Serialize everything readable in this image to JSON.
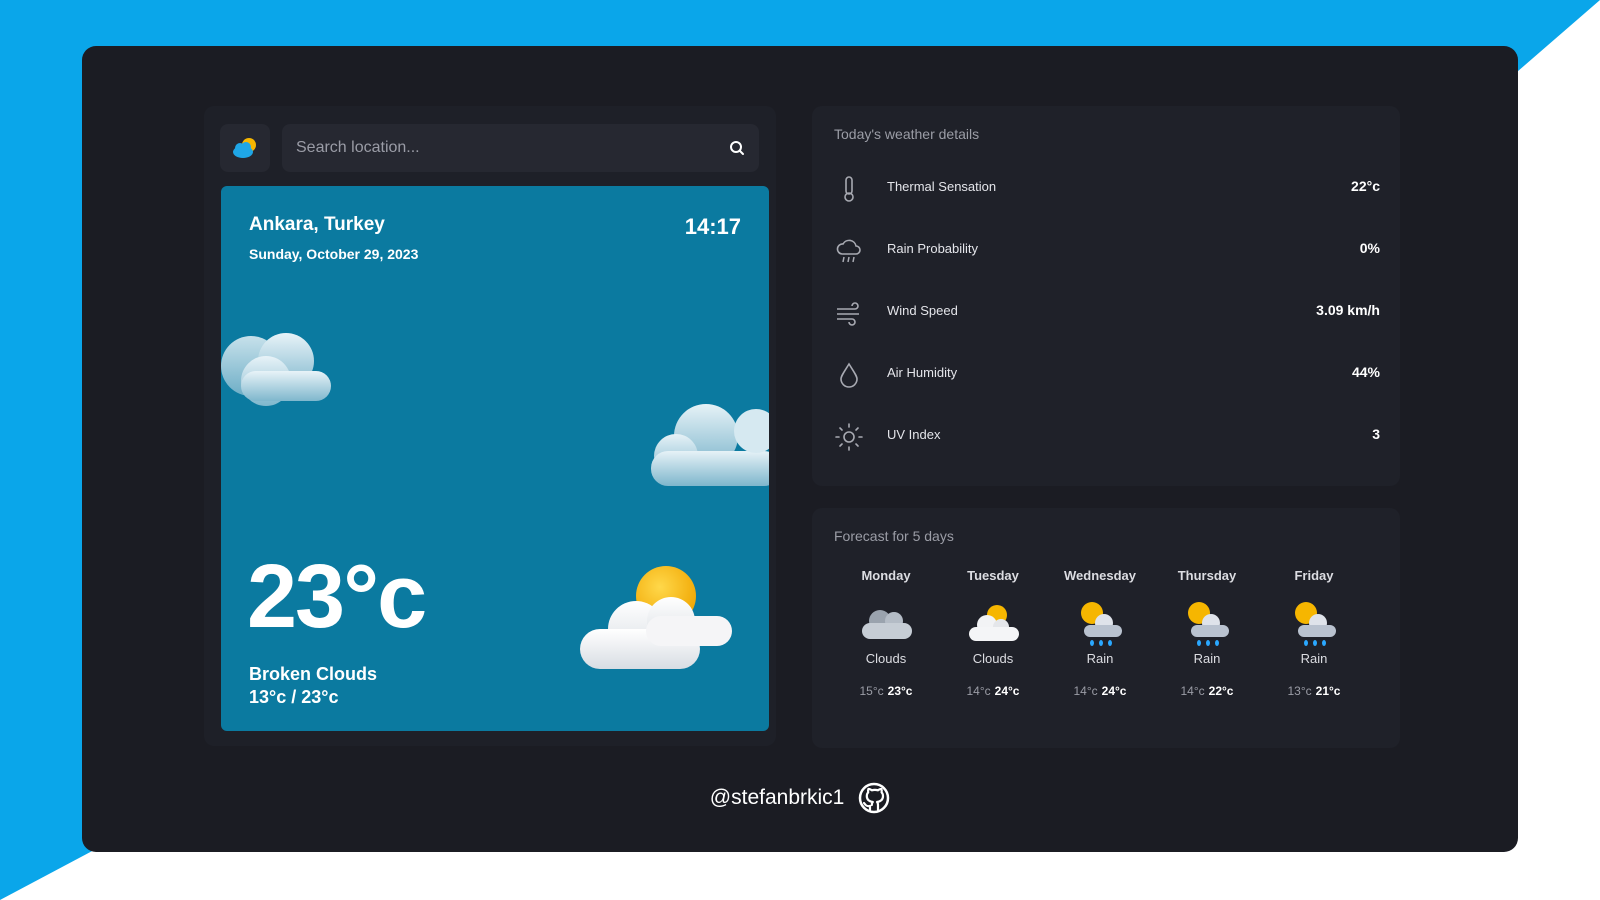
{
  "colors": {
    "background_blue": "#0aa6ea",
    "frame": "#1b1c23",
    "panel": "#1f2129",
    "card": "#0b7aa0",
    "sun": "#f6b600"
  },
  "app": {
    "logo_icon": "sun-cloud-logo-icon"
  },
  "search": {
    "placeholder": "Search location...",
    "icon": "search-icon"
  },
  "current": {
    "location": "Ankara, Turkey",
    "date": "Sunday, October 29, 2023",
    "time": "14:17",
    "temperature": "23°c",
    "condition": "Broken Clouds",
    "range": "13°c / 23°c"
  },
  "details": {
    "title": "Today's weather details",
    "items": [
      {
        "icon": "thermometer-icon",
        "label": "Thermal Sensation",
        "value": "22°c"
      },
      {
        "icon": "cloud-rain-icon",
        "label": "Rain Probability",
        "value": "0%"
      },
      {
        "icon": "wind-icon",
        "label": "Wind Speed",
        "value": "3.09 km/h"
      },
      {
        "icon": "droplet-icon",
        "label": "Air Humidity",
        "value": "44%"
      },
      {
        "icon": "sun-icon",
        "label": "UV Index",
        "value": "3"
      }
    ]
  },
  "forecast": {
    "title": "Forecast for 5 days",
    "days": [
      {
        "day": "Monday",
        "icon": "clouds-icon",
        "condition": "Clouds",
        "low": "15°c",
        "high": "23°c"
      },
      {
        "day": "Tuesday",
        "icon": "sun-clouds-icon",
        "condition": "Clouds",
        "low": "14°c",
        "high": "24°c"
      },
      {
        "day": "Wednesday",
        "icon": "sun-rain-icon",
        "condition": "Rain",
        "low": "14°c",
        "high": "24°c"
      },
      {
        "day": "Thursday",
        "icon": "sun-rain-icon",
        "condition": "Rain",
        "low": "14°c",
        "high": "22°c"
      },
      {
        "day": "Friday",
        "icon": "sun-rain-icon",
        "condition": "Rain",
        "low": "13°c",
        "high": "21°c"
      }
    ]
  },
  "footer": {
    "handle": "@stefanbrkic1",
    "icon": "github-icon"
  }
}
